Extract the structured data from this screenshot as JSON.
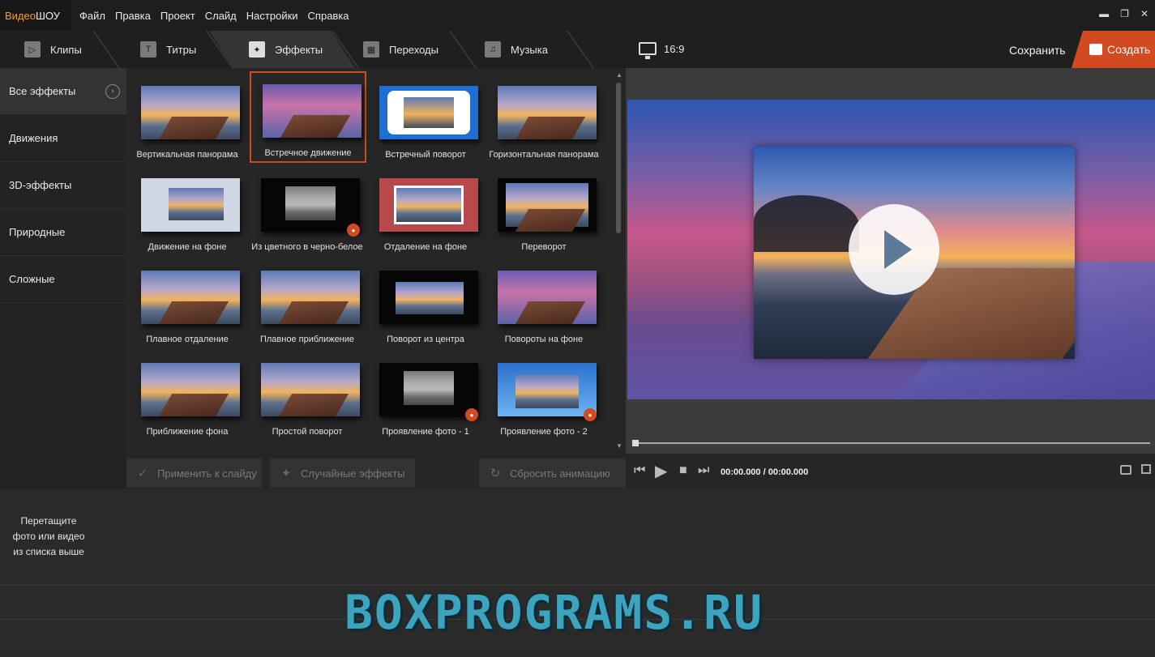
{
  "app": {
    "logo_part1": "Видео",
    "logo_part2": "ШОУ"
  },
  "menu": [
    "Файл",
    "Правка",
    "Проект",
    "Слайд",
    "Настройки",
    "Справка"
  ],
  "window_controls": {
    "minimize": "▬",
    "restore": "❐",
    "close": "✕"
  },
  "tabs": [
    {
      "label": "Клипы",
      "icon": "play-icon"
    },
    {
      "label": "Титры",
      "icon": "text-icon"
    },
    {
      "label": "Эффекты",
      "icon": "magic-wand-icon",
      "active": true
    },
    {
      "label": "Переходы",
      "icon": "clapper-icon"
    },
    {
      "label": "Музыка",
      "icon": "music-icon"
    }
  ],
  "categories": [
    {
      "label": "Все эффекты",
      "active": true
    },
    {
      "label": "Движения"
    },
    {
      "label": "3D-эффекты"
    },
    {
      "label": "Природные"
    },
    {
      "label": "Сложные"
    }
  ],
  "effects": [
    {
      "label": "Вертикальная панорама"
    },
    {
      "label": "Встречное движение",
      "selected": true
    },
    {
      "label": "Встречный поворот"
    },
    {
      "label": "Горизонтальная панорама"
    },
    {
      "label": "Движение на фоне"
    },
    {
      "label": "Из цветного в черно-белое",
      "badge": true
    },
    {
      "label": "Отдаление на фоне"
    },
    {
      "label": "Переворот"
    },
    {
      "label": "Плавное отдаление"
    },
    {
      "label": "Плавное приближение"
    },
    {
      "label": "Поворот из центра"
    },
    {
      "label": "Повороты на фоне"
    },
    {
      "label": "Приближение фона"
    },
    {
      "label": "Простой поворот"
    },
    {
      "label": "Проявление фото - 1",
      "badge": true
    },
    {
      "label": "Проявление фото - 2",
      "badge": true
    }
  ],
  "actions": {
    "apply": "Применить к слайду",
    "random": "Случайные эффекты",
    "reset": "Сбросить анимацию"
  },
  "preview": {
    "aspect_ratio": "16:9",
    "save_label": "Сохранить",
    "create_label": "Создать",
    "time": "00:00.000 / 00:00.000"
  },
  "timeline": {
    "hint_line1": "Перетащите",
    "hint_line2": "фото или видео",
    "hint_line3": "из списка выше"
  },
  "watermark": "BOXPROGRAMS.RU",
  "colors": {
    "accent": "#d24a22",
    "logo_orange": "#f0a030",
    "watermark": "#3da4c0"
  }
}
